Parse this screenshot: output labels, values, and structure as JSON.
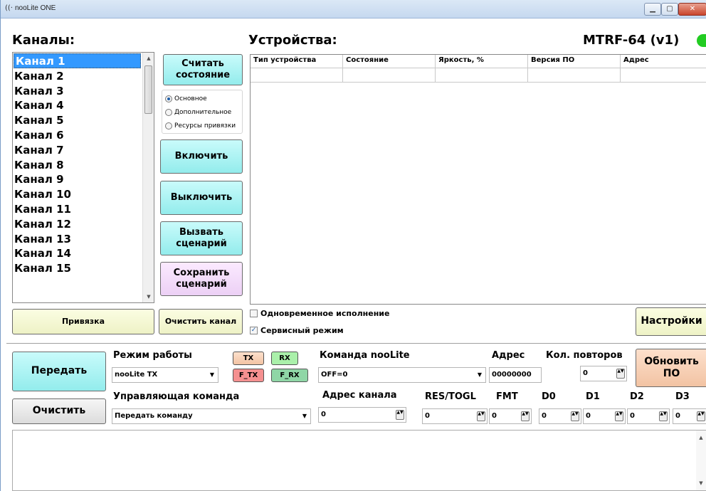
{
  "window": {
    "title": "nooLite ONE",
    "app_icon": "radio-waves-icon"
  },
  "channels": {
    "heading": "Каналы:",
    "items": [
      "Канал 1",
      "Канал 2",
      "Канал 3",
      "Канал 4",
      "Канал 5",
      "Канал 6",
      "Канал 7",
      "Канал 8",
      "Канал 9",
      "Канал 10",
      "Канал 11",
      "Канал 12",
      "Канал 13",
      "Канал 14",
      "Канал 15"
    ],
    "selected": 0
  },
  "devices": {
    "heading": "Устройства:",
    "model": "MTRF-64 (v1)",
    "status_color": "#22cc22",
    "columns": [
      "Тип устройства",
      "Состояние",
      "Яркость, %",
      "Версия ПО",
      "Адрес"
    ]
  },
  "actions": {
    "read_state": "Считать состояние",
    "radio_options": [
      "Основное",
      "Дополнительное",
      "Ресурсы привязки"
    ],
    "radio_selected": 0,
    "on": "Включить",
    "off": "Выключить",
    "call_scenario": "Вызвать сценарий",
    "save_scenario": "Сохранить сценарий",
    "bind": "Привязка",
    "clear_channel": "Очистить канал",
    "simultaneous": "Одновременное исполнение",
    "simultaneous_checked": false,
    "service_mode": "Сервисный режим",
    "service_mode_checked": true,
    "settings": "Настройки"
  },
  "panel": {
    "send": "Передать",
    "clear": "Очистить",
    "mode_label": "Режим работы",
    "mode_value": "nooLite TX",
    "tags": {
      "tx": "TX",
      "rx": "RX",
      "ftx": "F_TX",
      "frx": "F_RX"
    },
    "command_label": "Команда nooLite",
    "command_value": "OFF=0",
    "address_label": "Адрес",
    "address_value": "00000000",
    "repeats_label": "Кол. повторов",
    "repeats_value": "0",
    "update_fw": "Обновить ПО",
    "control_label": "Управляющая команда",
    "control_value": "Передать команду",
    "channel_addr_label": "Адрес канала",
    "channel_addr_value": "0",
    "res_label": "RES/TOGL",
    "res_value": "0",
    "fmt_label": "FMT",
    "fmt_value": "0",
    "d0_label": "D0",
    "d0_value": "0",
    "d1_label": "D1",
    "d1_value": "0",
    "d2_label": "D2",
    "d2_value": "0",
    "d3_label": "D3",
    "d3_value": "0"
  }
}
